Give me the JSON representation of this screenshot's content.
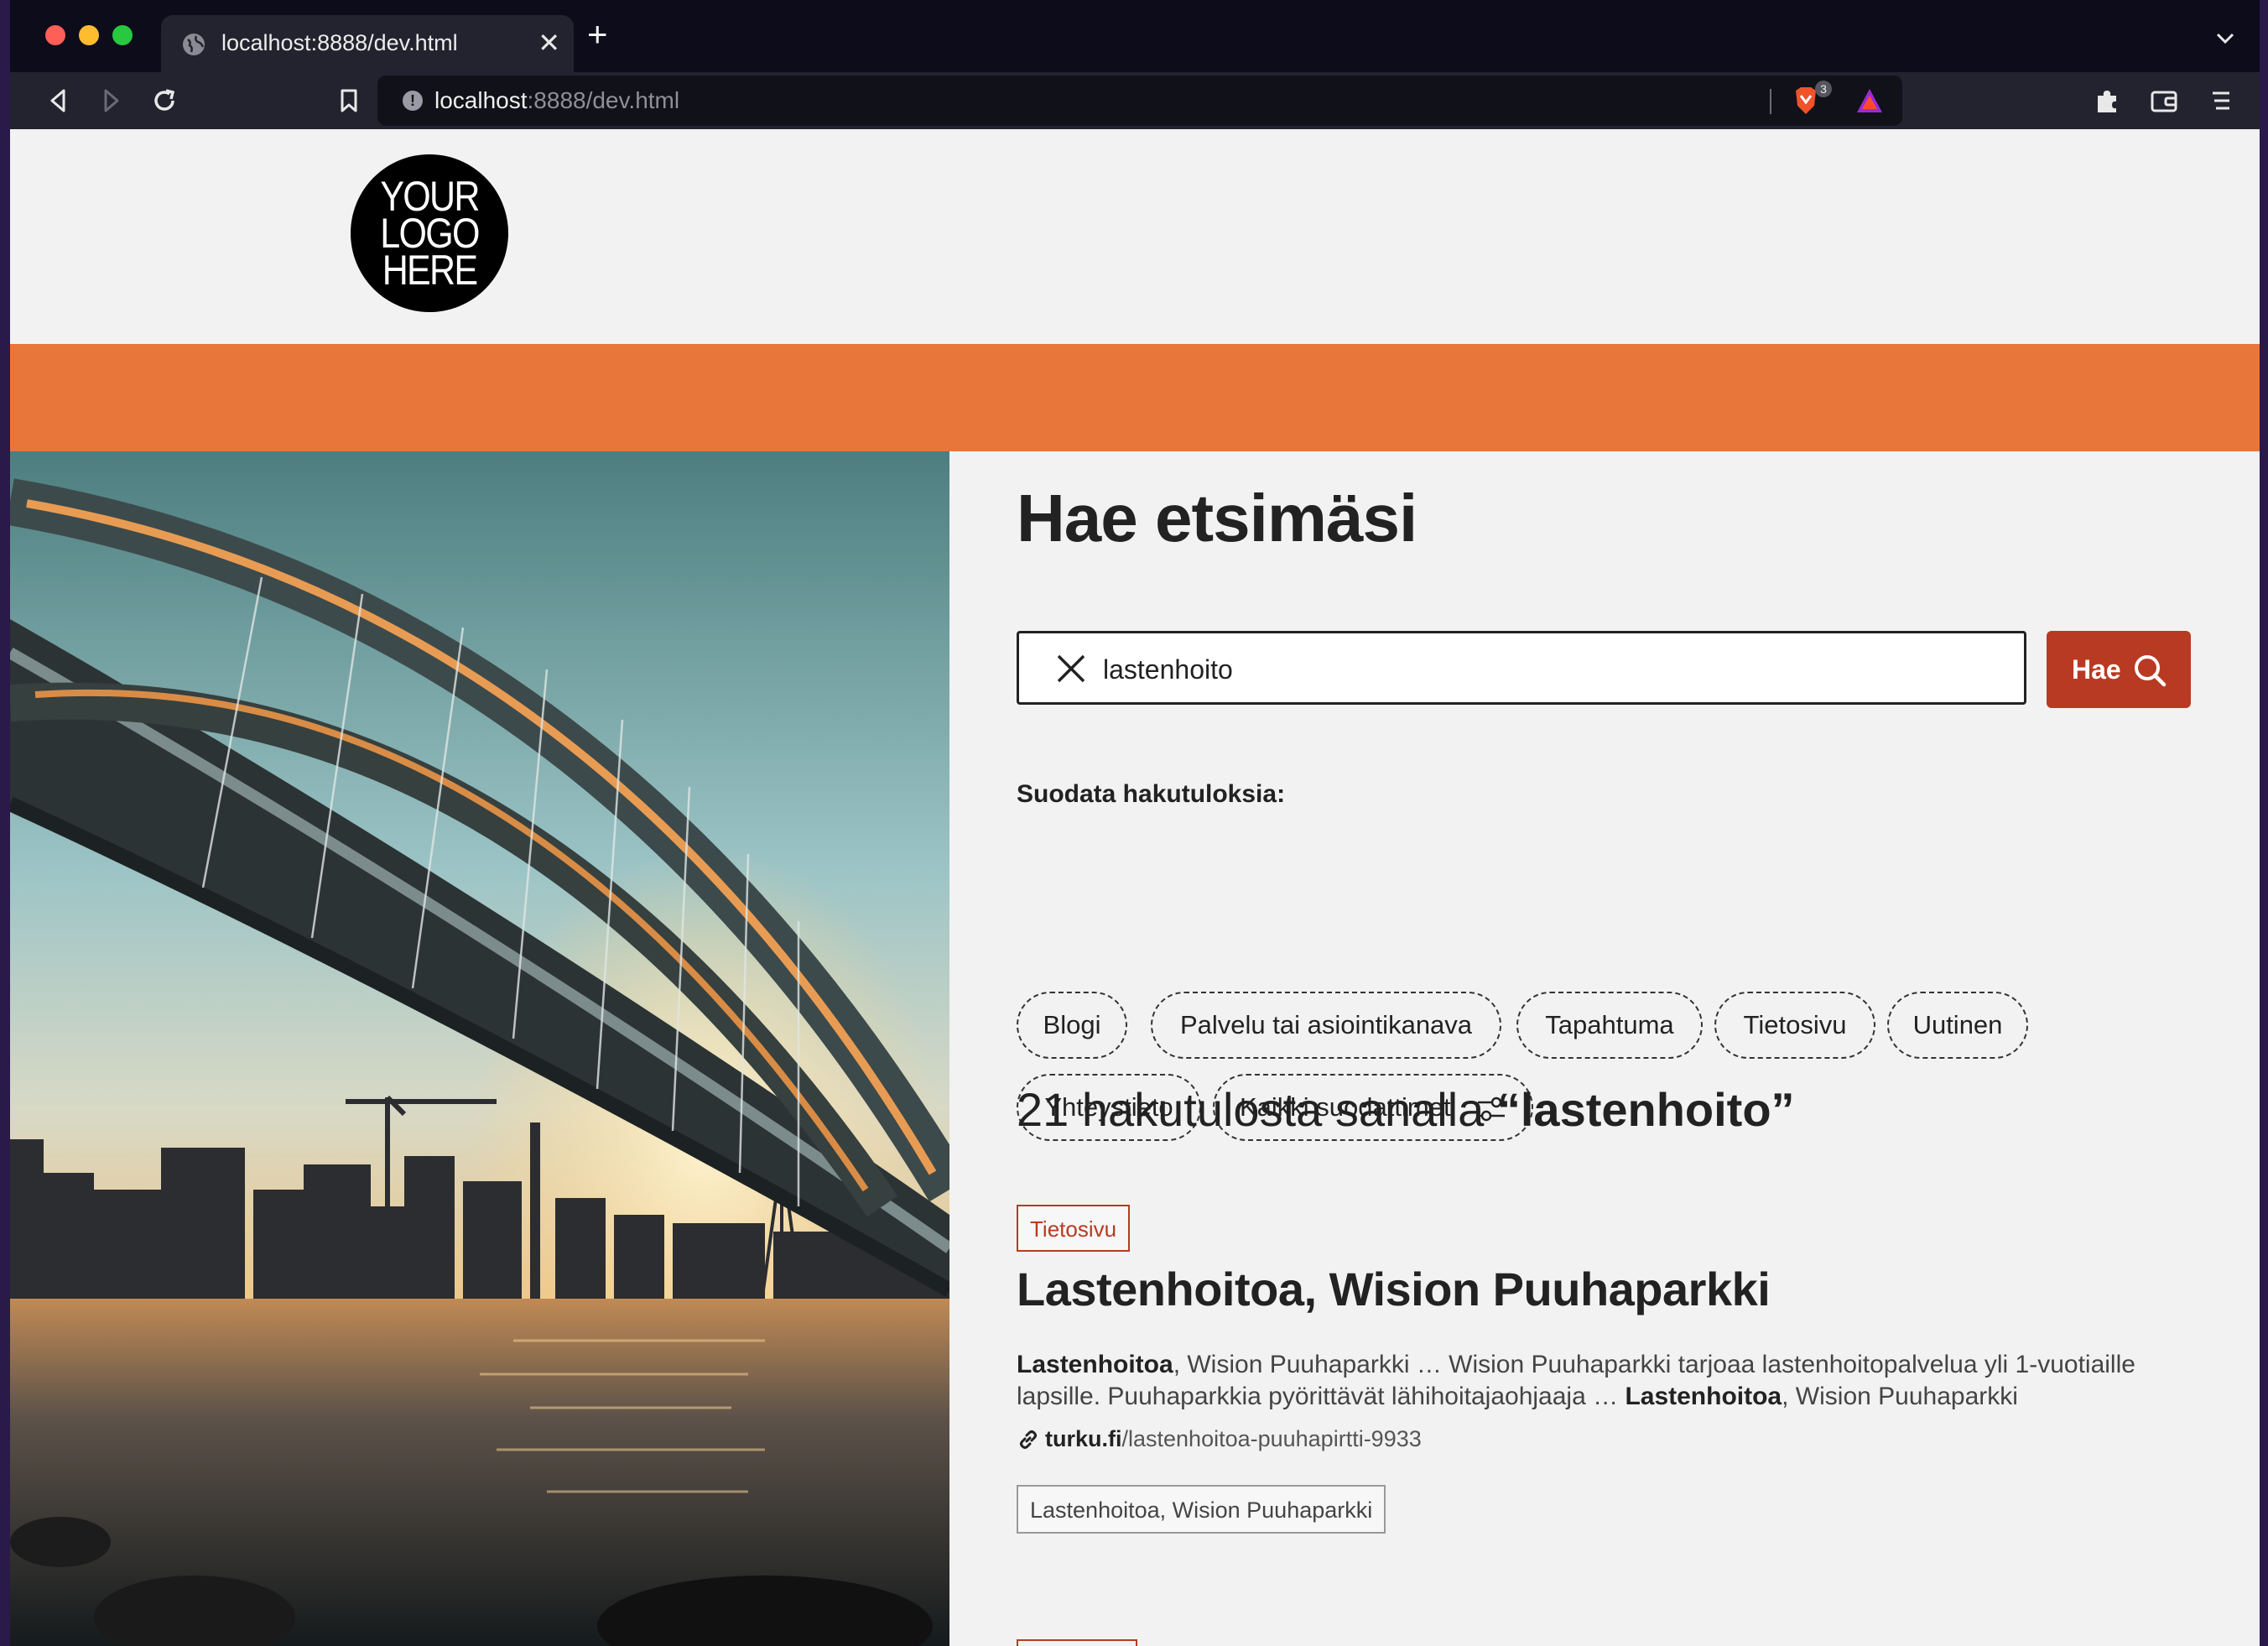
{
  "browser": {
    "tab_title": "localhost:8888/dev.html",
    "tab_close": "✕",
    "new_tab": "+",
    "url_host": "localhost",
    "url_rest": ":8888/dev.html",
    "shields_count": "3",
    "info": "!"
  },
  "header": {
    "logo_lines": [
      "YOUR",
      "LOGO",
      "HERE"
    ],
    "band_color": "#e8763a"
  },
  "search": {
    "heading": "Hae etsimäsi",
    "query": "lastenhoito",
    "button_label": "Hae",
    "accent_color": "#b93a22"
  },
  "filters": {
    "label": "Suodata hakutuloksia:",
    "chips": [
      "Blogi",
      "Palvelu tai asiointikanava",
      "Tapahtuma",
      "Tietosivu",
      "Uutinen",
      "Yhteystieto"
    ],
    "all_filters": "Kaikki suodattimet"
  },
  "results": {
    "count_prefix": "21 hakutulosta sanalla ",
    "count_term": "“lastenhoito”",
    "items": [
      {
        "type": "Tietosivu",
        "title": "Lastenhoitoa, Wision Puuhaparkki",
        "snippet_parts": [
          {
            "bold": true,
            "text": "Lastenhoitoa"
          },
          {
            "bold": false,
            "text": ", Wision Puuhaparkki … Wision Puuhaparkki tarjoaa lastenhoitopalvelua yli 1-vuotiaille lapsille. Puuhaparkkia pyörittävät lähihoitajaohjaaja … "
          },
          {
            "bold": true,
            "text": "Lastenhoitoa"
          },
          {
            "bold": false,
            "text": ", Wision Puuhaparkki"
          }
        ],
        "url_domain": "turku.fi",
        "url_path": "/lastenhoitoa-puuhapirtti-9933",
        "tag": "Lastenhoitoa, Wision Puuhaparkki"
      }
    ]
  }
}
